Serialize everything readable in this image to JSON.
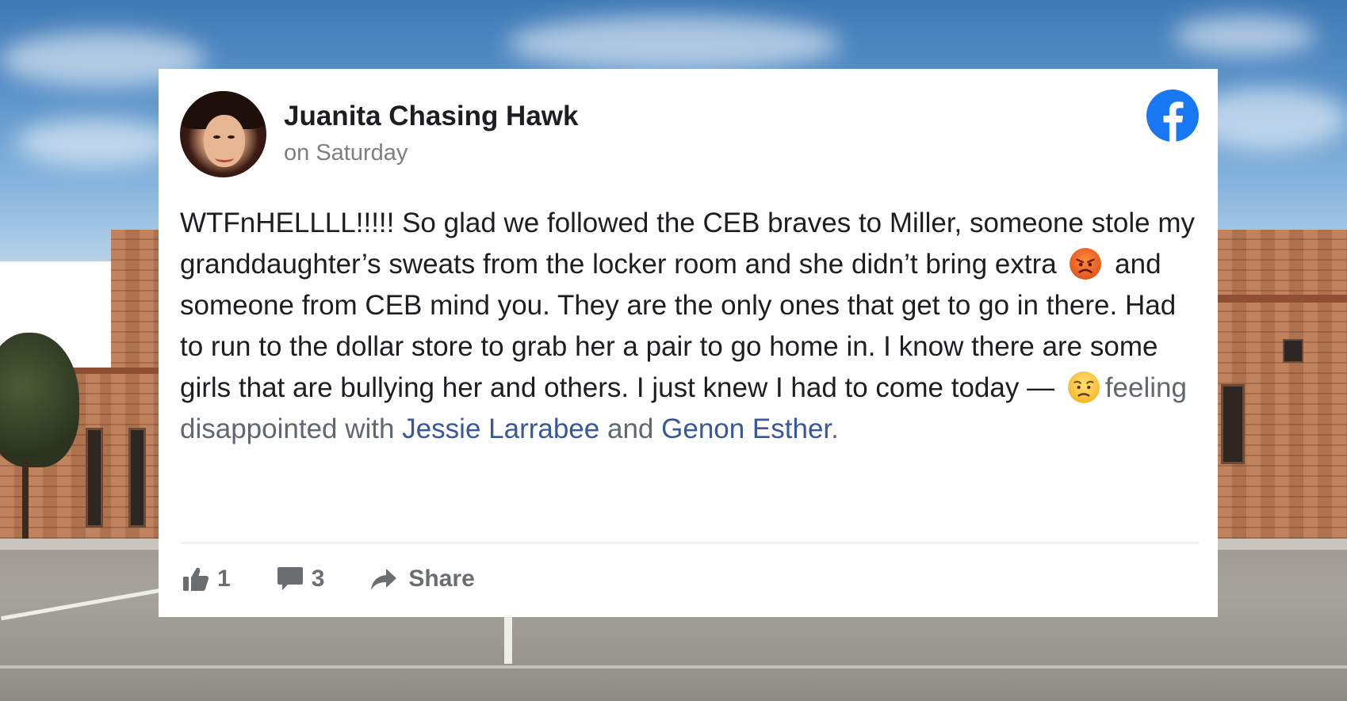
{
  "post": {
    "author": "Juanita Chasing Hawk",
    "timestamp": "on Saturday",
    "body": {
      "part1": "WTFnHELLLL!!!!! So glad we followed the CEB braves to Miller, someone stole my granddaughter’s sweats from the locker room and she didn’t bring extra",
      "part2": "and someone from CEB mind you. They are the only ones that get to go in there. Had to run to the dollar store to grab her a pair to go home in. I know there are some girls that are bullying her and others. I just knew I had to come today —",
      "feeling": "feeling disappointed with",
      "tag1": "Jessie Larrabee",
      "conjunction": "and",
      "tag2": "Genon Esther",
      "end": "."
    },
    "emojis": {
      "inline": "angry-face-emoji",
      "feeling": "disappointed-face-emoji"
    }
  },
  "actions": {
    "like_count": "1",
    "comment_count": "3",
    "share_label": "Share"
  },
  "icons": {
    "brand": "facebook-icon",
    "like": "thumbs-up-icon",
    "comment": "comment-icon",
    "share": "share-arrow-icon"
  },
  "colors": {
    "facebook_blue": "#1877f2",
    "link": "#385898",
    "action_gray": "#6a6d72"
  }
}
